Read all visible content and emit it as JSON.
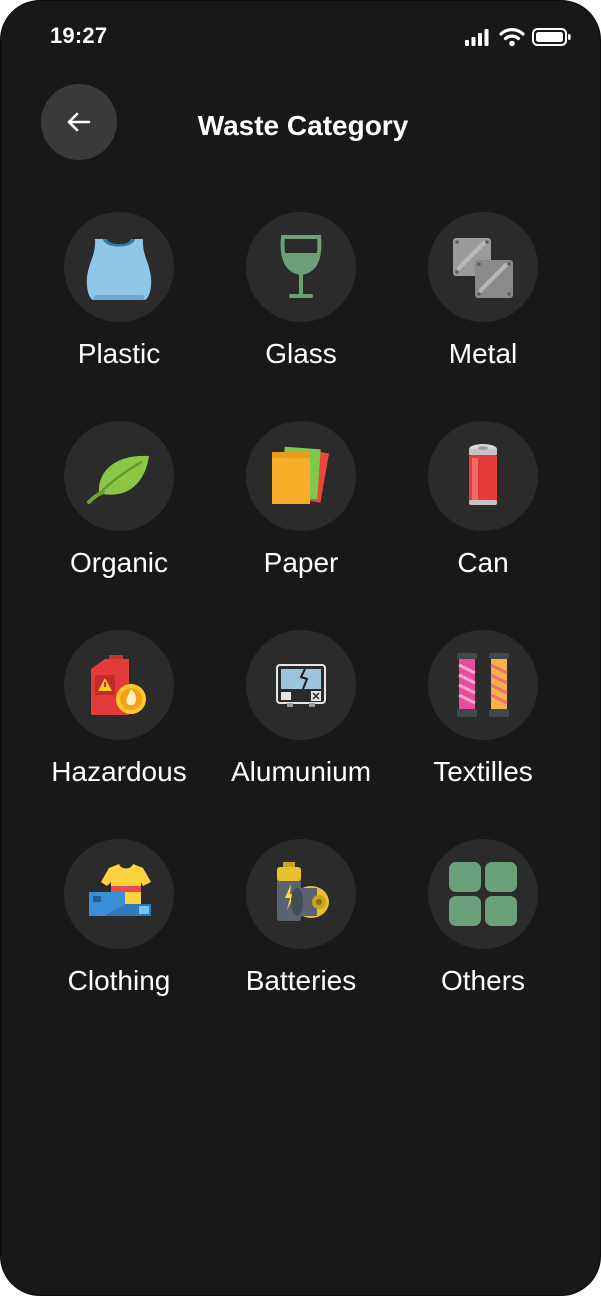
{
  "status_bar": {
    "time": "19:27"
  },
  "header": {
    "title": "Waste Category",
    "back_icon": "arrow-left-icon"
  },
  "categories": [
    {
      "label": "Plastic",
      "icon": "plastic-bag-icon"
    },
    {
      "label": "Glass",
      "icon": "wine-glass-icon"
    },
    {
      "label": "Metal",
      "icon": "metal-plates-icon"
    },
    {
      "label": "Organic",
      "icon": "leaf-icon"
    },
    {
      "label": "Paper",
      "icon": "paper-sheets-icon"
    },
    {
      "label": "Can",
      "icon": "soda-can-icon"
    },
    {
      "label": "Hazardous",
      "icon": "hazard-canister-icon"
    },
    {
      "label": "Alumunium",
      "icon": "broken-appliance-icon"
    },
    {
      "label": "Textilles",
      "icon": "thread-spools-icon"
    },
    {
      "label": "Clothing",
      "icon": "clothes-icon"
    },
    {
      "label": "Batteries",
      "icon": "batteries-icon"
    },
    {
      "label": "Others",
      "icon": "grid-icon"
    }
  ]
}
